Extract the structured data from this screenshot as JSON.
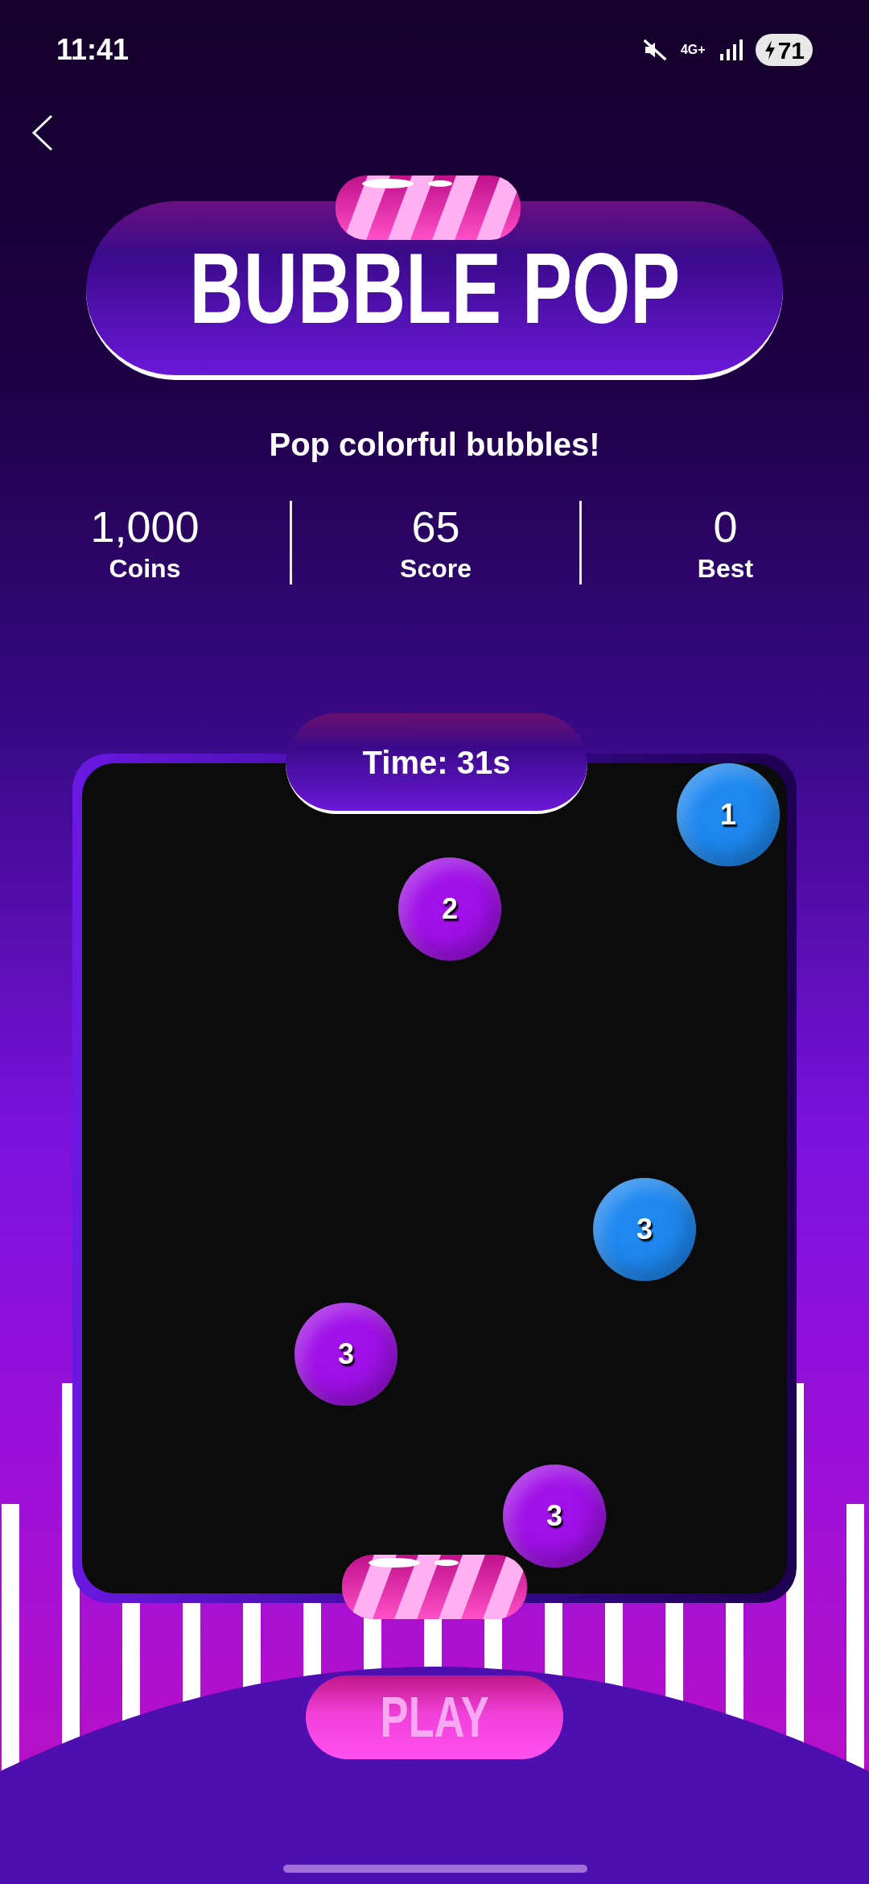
{
  "status_bar": {
    "time": "11:41",
    "network": "4G+",
    "battery": "71"
  },
  "title": "BUBBLE POP",
  "subtitle": "Pop colorful bubbles!",
  "stats": [
    {
      "value": "1,000",
      "label": "Coins"
    },
    {
      "value": "65",
      "label": "Score"
    },
    {
      "value": "0",
      "label": "Best"
    }
  ],
  "timer": "Time: 31s",
  "bubbles": [
    {
      "label": "1",
      "color": "#1e88f0"
    },
    {
      "label": "2",
      "color": "#a010e8"
    },
    {
      "label": "3",
      "color": "#1e88f0"
    },
    {
      "label": "3",
      "color": "#a010e8"
    },
    {
      "label": "3",
      "color": "#a010e8"
    }
  ],
  "play_button": {
    "label": "PLAY",
    "disabled": true
  }
}
